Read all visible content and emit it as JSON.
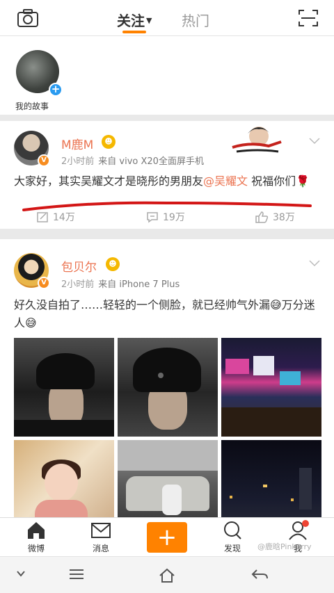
{
  "header": {
    "tabs": [
      {
        "label": "关注",
        "active": true
      },
      {
        "label": "热门",
        "active": false
      }
    ],
    "accent_color": "#ff8200"
  },
  "stories": {
    "items": [
      {
        "label": "我的故事"
      }
    ]
  },
  "posts": [
    {
      "username": "M鹿M",
      "time": "2小时前",
      "source": "来自 vivo X20全面屏手机",
      "text_before": "大家好，其实吴耀文才是晓彤的男朋友",
      "mention": "@吴耀文",
      "text_after": " 祝福你们🌹",
      "reposts": "14万",
      "comments": "19万",
      "likes": "38万"
    },
    {
      "username": "包贝尔",
      "time": "2小时前",
      "source": "来自 iPhone 7 Plus",
      "text": "好久没自拍了……轻轻的一个侧脸，就已经帅气外漏😅万分迷人😅",
      "photos": 6
    }
  ],
  "bottom_nav": {
    "items": [
      {
        "label": "微博"
      },
      {
        "label": "消息"
      },
      {
        "label": "发现"
      },
      {
        "label": "我"
      }
    ],
    "compose_label": "+"
  },
  "watermark": "@鹿晗Pinkerry",
  "icons": [
    "camera-icon",
    "scan-icon",
    "plus-icon",
    "chevron-down-icon",
    "repost-icon",
    "comment-icon",
    "like-icon",
    "home-icon",
    "mail-icon",
    "search-icon",
    "person-icon"
  ]
}
